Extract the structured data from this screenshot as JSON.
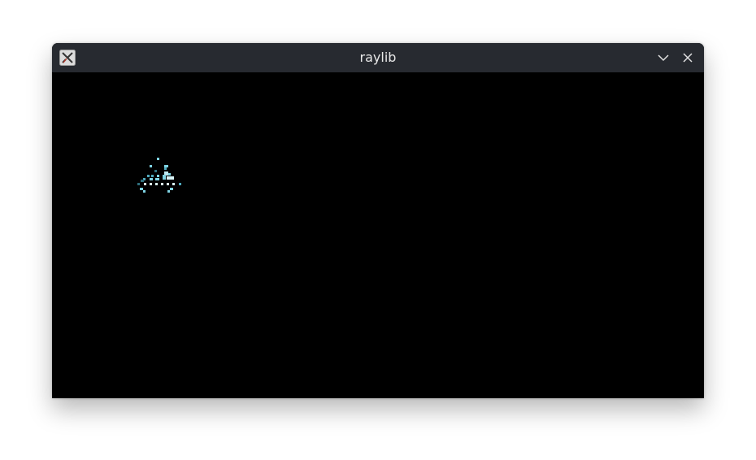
{
  "window": {
    "title": "raylib",
    "app_icon": "x11-app-icon",
    "controls": [
      "minimize-chevron-icon",
      "close-icon"
    ]
  },
  "canvas": {
    "background": "#000000",
    "sprite": "pixel-art-ship-sprite"
  },
  "colors": {
    "titlebar_bg": "#272a30",
    "title_text": "#e8e8e8",
    "sprite_primary": "#7fd3e3",
    "sprite_light": "#d8f4f8",
    "sprite_dark": "#2f6f7d"
  }
}
